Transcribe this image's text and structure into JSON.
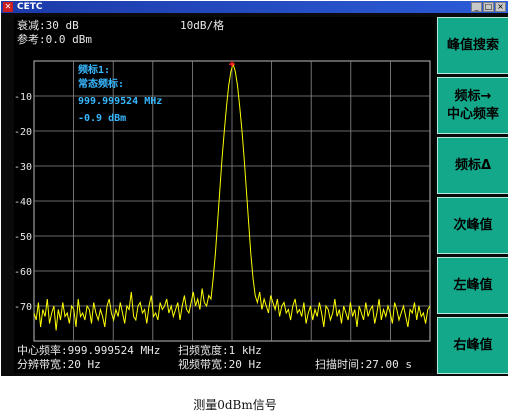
{
  "window": {
    "title": "CETC"
  },
  "header": {
    "attenuation": "衰减:30 dB",
    "reference": "参考:0.0 dBm",
    "scale": "10dB/格"
  },
  "marker": {
    "name": "频标1:",
    "mode": "常态频标:",
    "frequency": "999.999524 MHz",
    "level": "-0.9 dBm"
  },
  "footer": {
    "center_freq": "中心频率:999.999524 MHz",
    "span": "扫频宽度:1 kHz",
    "rbw": "分辨带宽:20 Hz",
    "vbw": "视频带宽:20 Hz",
    "sweep_time": "扫描时间:27.00 s"
  },
  "softkeys": [
    {
      "line1": "峰值搜索",
      "line2": ""
    },
    {
      "line1": "频标→",
      "line2": "中心频率"
    },
    {
      "line1": "频标Δ",
      "line2": ""
    },
    {
      "line1": "次峰值",
      "line2": ""
    },
    {
      "line1": "左峰值",
      "line2": ""
    },
    {
      "line1": "右峰值",
      "line2": ""
    }
  ],
  "caption": "测量0dBm信号",
  "colors": {
    "trace": "#ffff00",
    "marker_text": "#38b8ff",
    "grid": "#8a8a8a",
    "softkey": "#13a88a"
  },
  "chart_data": {
    "type": "line",
    "y_tick_labels": [
      "-10",
      "-20",
      "-30",
      "-40",
      "-50",
      "-60",
      "-70"
    ],
    "ylim": [
      -80,
      0
    ],
    "x_divisions": 10,
    "y_divisions": 8,
    "grid": true,
    "peak": {
      "x_division": 5,
      "y": -0.9
    },
    "noise_floor": -70,
    "series": [
      {
        "values": [
          -72,
          -74,
          -69,
          -76,
          -71,
          -73,
          -68,
          -75,
          -72,
          -70,
          -77,
          -71,
          -74,
          -69,
          -73,
          -72,
          -75,
          -70,
          -71,
          -76,
          -68,
          -73,
          -72,
          -74,
          -70,
          -71,
          -75,
          -69,
          -72,
          -74,
          -71,
          -73,
          -76,
          -70,
          -68,
          -72,
          -74,
          -71,
          -73,
          -69,
          -72,
          -75,
          -70,
          -71,
          -66,
          -73,
          -74,
          -70,
          -69,
          -72,
          -71,
          -75,
          -70,
          -67,
          -73,
          -72,
          -74,
          -69,
          -71,
          -70,
          -68,
          -72,
          -70,
          -73,
          -71,
          -69,
          -74,
          -70,
          -67,
          -71,
          -72,
          -69,
          -66,
          -70,
          -68,
          -71,
          -65,
          -69,
          -70,
          -67,
          -68,
          -62,
          -55,
          -46,
          -37,
          -28,
          -20,
          -13,
          -7,
          -3,
          -0.9,
          -3,
          -7,
          -13,
          -20,
          -28,
          -37,
          -46,
          -55,
          -62,
          -67,
          -69,
          -66,
          -71,
          -68,
          -70,
          -72,
          -67,
          -69,
          -71,
          -68,
          -73,
          -70,
          -69,
          -72,
          -71,
          -74,
          -70,
          -68,
          -72,
          -71,
          -73,
          -69,
          -75,
          -72,
          -70,
          -74,
          -71,
          -73,
          -69,
          -72,
          -76,
          -70,
          -71,
          -74,
          -72,
          -68,
          -73,
          -71,
          -75,
          -70,
          -72,
          -74,
          -69,
          -73,
          -71,
          -76,
          -70,
          -72,
          -74,
          -69,
          -73,
          -71,
          -70,
          -75,
          -72,
          -68,
          -74,
          -71,
          -73,
          -70,
          -72,
          -75,
          -69,
          -71,
          -74,
          -72,
          -70,
          -73,
          -76,
          -71,
          -72,
          -69,
          -74,
          -70,
          -73,
          -72,
          -75,
          -71,
          -70
        ]
      }
    ]
  }
}
